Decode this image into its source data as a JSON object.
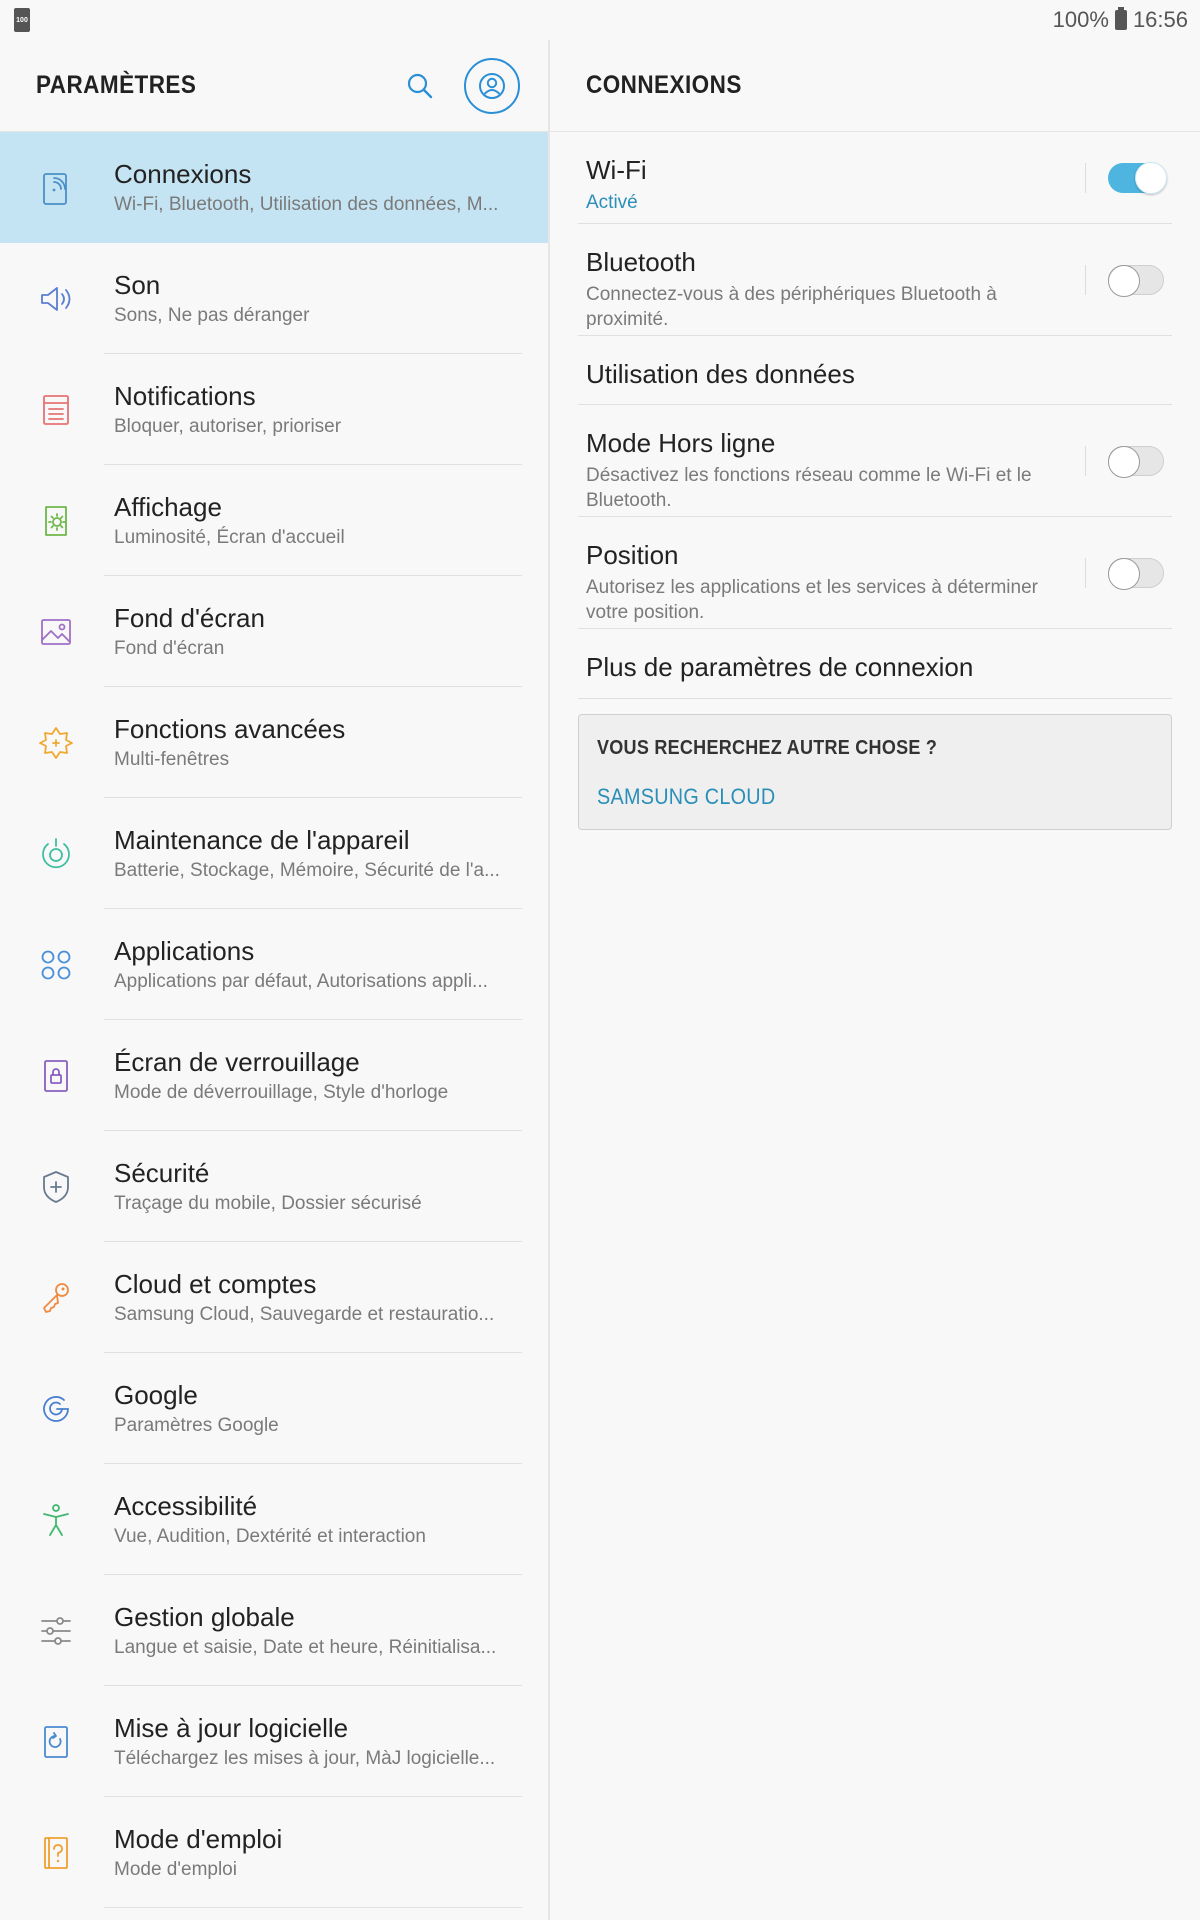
{
  "status_bar": {
    "notification_icon_text": "100",
    "battery_percent": "100%",
    "time": "16:56"
  },
  "left": {
    "title": "PARAMÈTRES",
    "items": [
      {
        "title": "Connexions",
        "subtitle": "Wi-Fi, Bluetooth, Utilisation des données, M...",
        "icon": "connections-icon",
        "color": "#4a90c8",
        "active": true
      },
      {
        "title": "Son",
        "subtitle": "Sons, Ne pas déranger",
        "icon": "speaker-icon",
        "color": "#5b7fd0"
      },
      {
        "title": "Notifications",
        "subtitle": "Bloquer, autoriser, prioriser",
        "icon": "notifications-icon",
        "color": "#e57373"
      },
      {
        "title": "Affichage",
        "subtitle": "Luminosité, Écran d'accueil",
        "icon": "display-icon",
        "color": "#6fb84a"
      },
      {
        "title": "Fond d'écran",
        "subtitle": "Fond d'écran",
        "icon": "wallpaper-icon",
        "color": "#a070c8"
      },
      {
        "title": "Fonctions avancées",
        "subtitle": "Multi-fenêtres",
        "icon": "advanced-features-icon",
        "color": "#f0a830"
      },
      {
        "title": "Maintenance de l'appareil",
        "subtitle": "Batterie, Stockage, Mémoire, Sécurité de l'a...",
        "icon": "device-maintenance-icon",
        "color": "#3fbf9f"
      },
      {
        "title": "Applications",
        "subtitle": "Applications par défaut, Autorisations appli...",
        "icon": "applications-icon",
        "color": "#4a90d8"
      },
      {
        "title": "Écran de verrouillage",
        "subtitle": "Mode de déverrouillage, Style d'horloge",
        "icon": "lock-screen-icon",
        "color": "#8a60c0"
      },
      {
        "title": "Sécurité",
        "subtitle": "Traçage du mobile, Dossier sécurisé",
        "icon": "shield-icon",
        "color": "#6a7a90"
      },
      {
        "title": "Cloud et comptes",
        "subtitle": "Samsung Cloud, Sauvegarde et restauratio...",
        "icon": "key-icon",
        "color": "#f08a40"
      },
      {
        "title": "Google",
        "subtitle": "Paramètres Google",
        "icon": "google-icon",
        "color": "#4a80d0"
      },
      {
        "title": "Accessibilité",
        "subtitle": "Vue, Audition, Dextérité et interaction",
        "icon": "accessibility-icon",
        "color": "#40b870"
      },
      {
        "title": "Gestion globale",
        "subtitle": "Langue et saisie, Date et heure, Réinitialisa...",
        "icon": "sliders-icon",
        "color": "#8a8a8a"
      },
      {
        "title": "Mise à jour logicielle",
        "subtitle": "Téléchargez les mises à jour, MàJ logicielle...",
        "icon": "software-update-icon",
        "color": "#4a8ad0"
      },
      {
        "title": "Mode d'emploi",
        "subtitle": "Mode d'emploi",
        "icon": "user-manual-icon",
        "color": "#f0a030"
      }
    ]
  },
  "right": {
    "title": "CONNEXIONS",
    "settings": [
      {
        "title": "Wi-Fi",
        "subtitle": "Activé",
        "toggle": "on"
      },
      {
        "title": "Bluetooth",
        "subtitle": "Connectez-vous à des périphériques Bluetooth à proximité.",
        "toggle": "off"
      },
      {
        "title": "Utilisation des données",
        "subtitle": "",
        "toggle": "none"
      },
      {
        "title": "Mode Hors ligne",
        "subtitle": "Désactivez les fonctions réseau comme le Wi-Fi et le Bluetooth.",
        "toggle": "off"
      },
      {
        "title": "Position",
        "subtitle": "Autorisez les applications et les services à déterminer votre position.",
        "toggle": "off"
      },
      {
        "title": "Plus de paramètres de connexion",
        "subtitle": "",
        "toggle": "none"
      }
    ],
    "looking_for": {
      "title": "VOUS RECHERCHEZ AUTRE CHOSE ?",
      "link": "SAMSUNG CLOUD"
    }
  },
  "colors": {
    "accent": "#2a8fd6",
    "active_row": "#c5e4f3",
    "toggle_on": "#4eb4e0"
  }
}
